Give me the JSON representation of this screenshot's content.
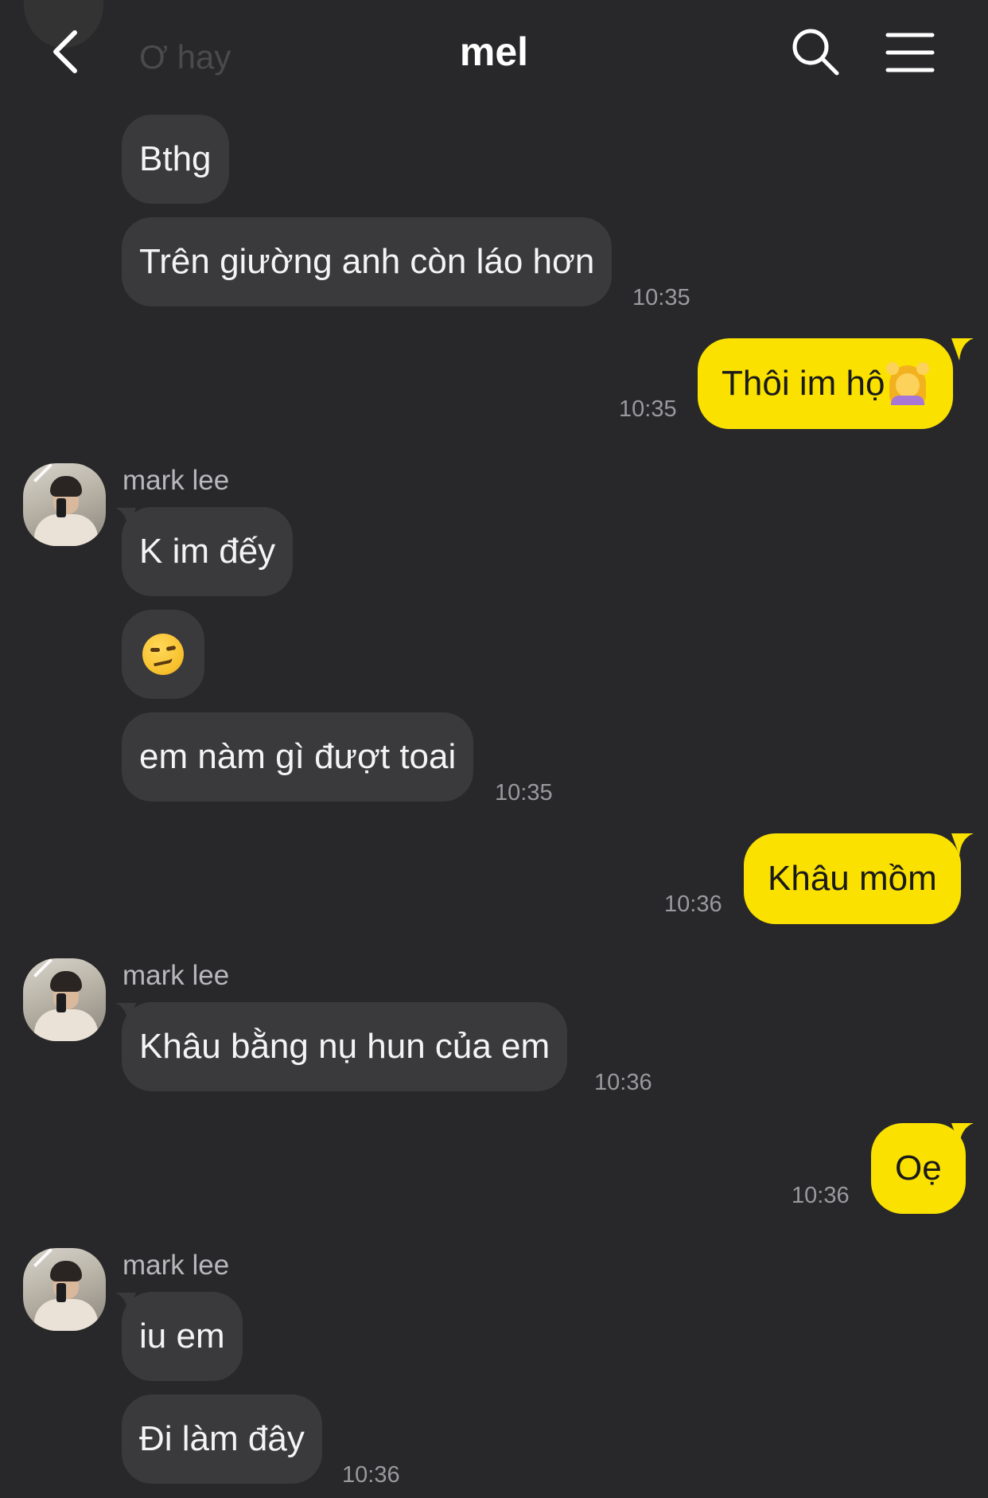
{
  "header": {
    "title": "mel",
    "ghost_preview": "Ơ hay"
  },
  "icons": {
    "back": "chevron-left-icon",
    "search": "search-icon",
    "menu": "hamburger-menu-icon"
  },
  "colors": {
    "background": "#28282a",
    "incoming_bubble": "#3a3a3c",
    "outgoing_bubble": "#fae100",
    "timestamp": "#9a9a9e"
  },
  "messages": {
    "m1": {
      "text": "Bthg"
    },
    "m2": {
      "text": "Trên giường anh còn láo hơn",
      "time": "10:35"
    },
    "m3": {
      "text": "Thôi im hộ",
      "emoji": "person-getting-massage-emoji",
      "time": "10:35"
    },
    "g1": {
      "sender": "mark lee"
    },
    "m4": {
      "text": "K im đếy"
    },
    "m5": {
      "emoji": "smirking-face-emoji"
    },
    "m6": {
      "text": "em nàm gì đượt toai",
      "time": "10:35"
    },
    "m7": {
      "text": "Khâu mồm",
      "time": "10:36"
    },
    "g2": {
      "sender": "mark lee"
    },
    "m8": {
      "text": "Khâu bằng nụ hun của em",
      "time": "10:36"
    },
    "m9": {
      "text": "Oẹ",
      "time": "10:36"
    },
    "g3": {
      "sender": "mark lee"
    },
    "m10": {
      "text": "iu em"
    },
    "m11": {
      "text": "Đi làm đây",
      "time": "10:36"
    }
  }
}
